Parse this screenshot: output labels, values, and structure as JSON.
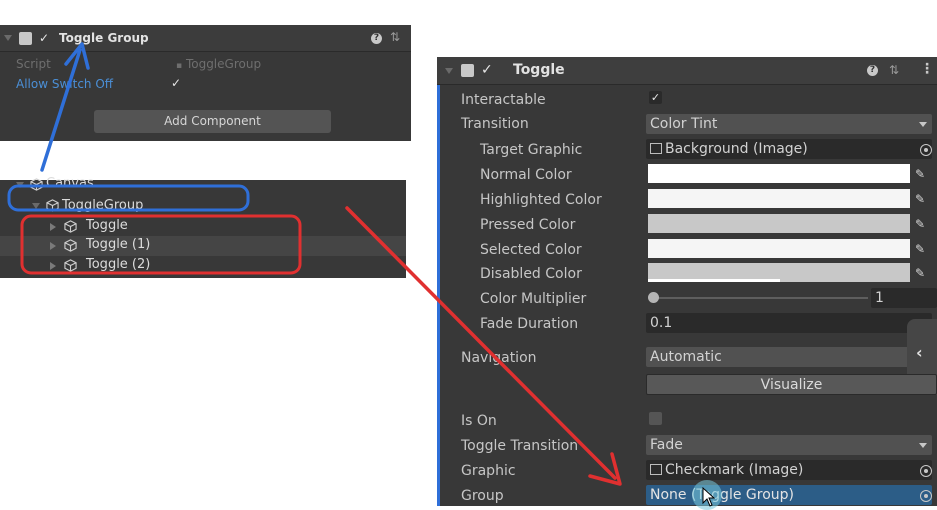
{
  "toggle_group_inspector": {
    "title": "Toggle Group",
    "script_label": "Script",
    "script_value": "ToggleGroup",
    "allow_switch_off_label": "Allow Switch Off",
    "allow_switch_off_checked": true,
    "add_component_label": "Add Component"
  },
  "hierarchy": {
    "items": [
      {
        "label": "Canvas"
      },
      {
        "label": "ToggleGroup"
      },
      {
        "label": "Toggle"
      },
      {
        "label": "Toggle (1)"
      },
      {
        "label": "Toggle (2)"
      }
    ]
  },
  "toggle_inspector": {
    "title": "Toggle",
    "interactable_label": "Interactable",
    "interactable_checked": true,
    "transition_label": "Transition",
    "transition_value": "Color Tint",
    "target_graphic_label": "Target Graphic",
    "target_graphic_value": "Background (Image)",
    "normal_color_label": "Normal Color",
    "highlighted_color_label": "Highlighted Color",
    "pressed_color_label": "Pressed Color",
    "selected_color_label": "Selected Color",
    "disabled_color_label": "Disabled Color",
    "color_multiplier_label": "Color Multiplier",
    "color_multiplier_value": "1",
    "fade_duration_label": "Fade Duration",
    "fade_duration_value": "0.1",
    "navigation_label": "Navigation",
    "navigation_value": "Automatic",
    "visualize_label": "Visualize",
    "is_on_label": "Is On",
    "is_on_checked": false,
    "toggle_transition_label": "Toggle Transition",
    "toggle_transition_value": "Fade",
    "graphic_label": "Graphic",
    "graphic_value": "Checkmark (Image)",
    "group_label": "Group",
    "group_value": "None (Toggle Group)"
  },
  "colors": {
    "panel_bg": "#383838",
    "annotation_blue": "#2f6fd8",
    "annotation_red": "#e03030",
    "selection_blue": "#2c5d87",
    "normal_color": "#ffffff",
    "highlighted_color": "#f5f5f5",
    "pressed_color": "#c8c8c8",
    "selected_color": "#f5f5f5",
    "disabled_color": "#c8c8c8"
  },
  "icons": [
    "help-icon",
    "presets-icon",
    "kebab-icon",
    "eyedropper-icon",
    "object-picker-icon",
    "gameobject-icon",
    "chevron-left-icon",
    "mouse-cursor-icon"
  ]
}
